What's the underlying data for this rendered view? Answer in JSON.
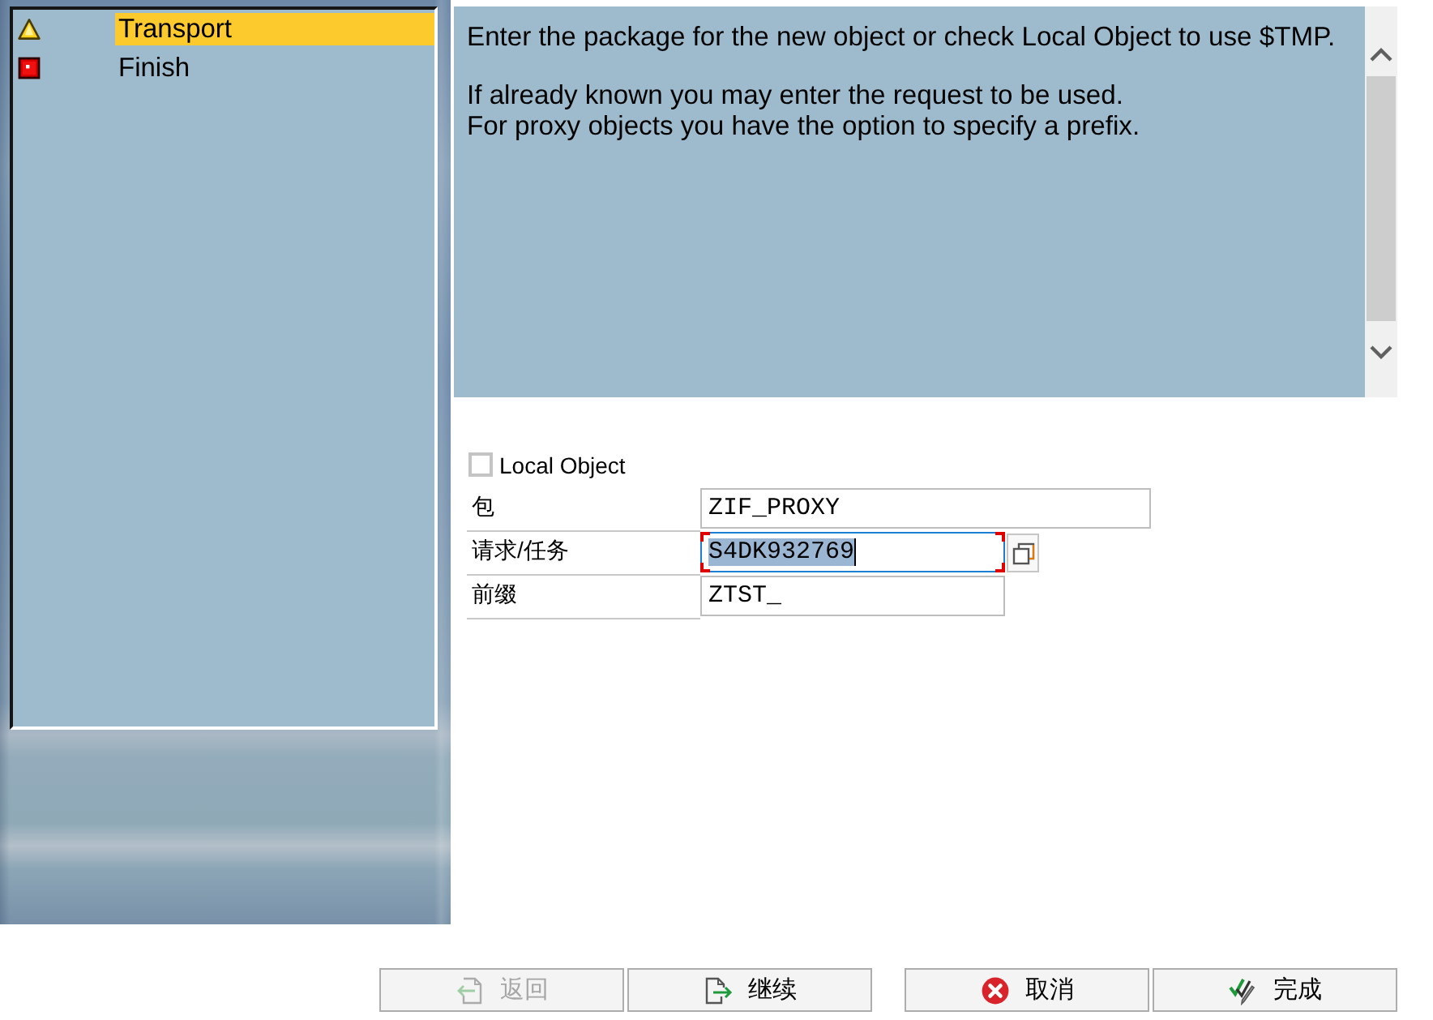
{
  "steps": [
    {
      "label": "Transport",
      "kind": "warning",
      "selected": true
    },
    {
      "label": "Finish",
      "kind": "error",
      "selected": false
    }
  ],
  "help": {
    "paragraphs": [
      {
        "lines": [
          "Enter the package for the new object or check Local Object to use $TMP."
        ]
      },
      {
        "lines": [
          "If already known you may enter the request to be used.",
          "For proxy objects you have the option to specify a prefix."
        ]
      }
    ]
  },
  "local_object": {
    "label": "Local Object",
    "checked": false
  },
  "fields": [
    {
      "label": "包",
      "value": "ZIF_PROXY",
      "focused": false,
      "value_help": false
    },
    {
      "label": "请求/任务",
      "value": "S4DK932769",
      "focused": true,
      "value_help": true
    },
    {
      "label": "前缀",
      "value": "ZTST_",
      "focused": false,
      "value_help": false
    }
  ],
  "button_groups": [
    [
      {
        "label": "返回",
        "kind": "back",
        "disabled": true
      },
      {
        "label": "继续",
        "kind": "continue",
        "disabled": false
      }
    ],
    [
      {
        "label": "取消",
        "kind": "cancel",
        "disabled": false
      },
      {
        "label": "完成",
        "kind": "complete",
        "disabled": false
      }
    ]
  ]
}
